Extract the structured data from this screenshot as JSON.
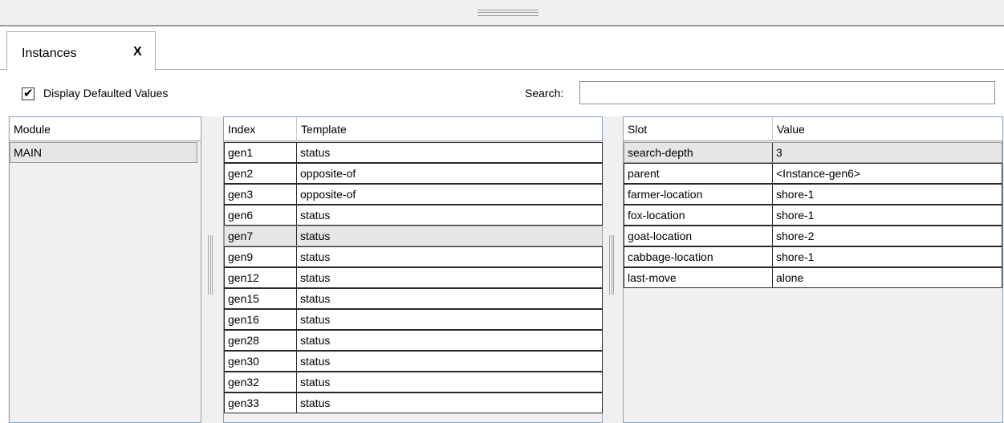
{
  "tab": {
    "label": "Instances",
    "close_label": "X"
  },
  "toolbar": {
    "checkbox_label": "Display Defaulted Values",
    "checkbox_checked": true,
    "search_label": "Search:",
    "search_value": ""
  },
  "modules": {
    "header": "Module",
    "rows": [
      {
        "name": "MAIN",
        "selected": true
      }
    ]
  },
  "instances": {
    "headers": [
      "Index",
      "Template"
    ],
    "rows": [
      {
        "index": "gen1",
        "template": "status"
      },
      {
        "index": "gen2",
        "template": "opposite-of"
      },
      {
        "index": "gen3",
        "template": "opposite-of"
      },
      {
        "index": "gen6",
        "template": "status"
      },
      {
        "index": "gen7",
        "template": "status",
        "selected": true
      },
      {
        "index": "gen9",
        "template": "status"
      },
      {
        "index": "gen12",
        "template": "status"
      },
      {
        "index": "gen15",
        "template": "status"
      },
      {
        "index": "gen16",
        "template": "status"
      },
      {
        "index": "gen28",
        "template": "status"
      },
      {
        "index": "gen30",
        "template": "status"
      },
      {
        "index": "gen32",
        "template": "status"
      },
      {
        "index": "gen33",
        "template": "status"
      }
    ]
  },
  "slots": {
    "headers": [
      "Slot",
      "Value"
    ],
    "rows": [
      {
        "slot": "search-depth",
        "value": "3",
        "selected": true
      },
      {
        "slot": "parent",
        "value": "<Instance-gen6>"
      },
      {
        "slot": "farmer-location",
        "value": "shore-1"
      },
      {
        "slot": "fox-location",
        "value": "shore-1"
      },
      {
        "slot": "goat-location",
        "value": "shore-2"
      },
      {
        "slot": "cabbage-location",
        "value": "shore-1"
      },
      {
        "slot": "last-move",
        "value": "alone"
      }
    ]
  },
  "colors": {
    "pane_border": "#8aa2c1",
    "pane_background": "#f0f0f0",
    "selected_row": "#e6e6e6"
  },
  "icons": {
    "checkbox": "check-mark-icon",
    "splitter": "grip-icon"
  }
}
